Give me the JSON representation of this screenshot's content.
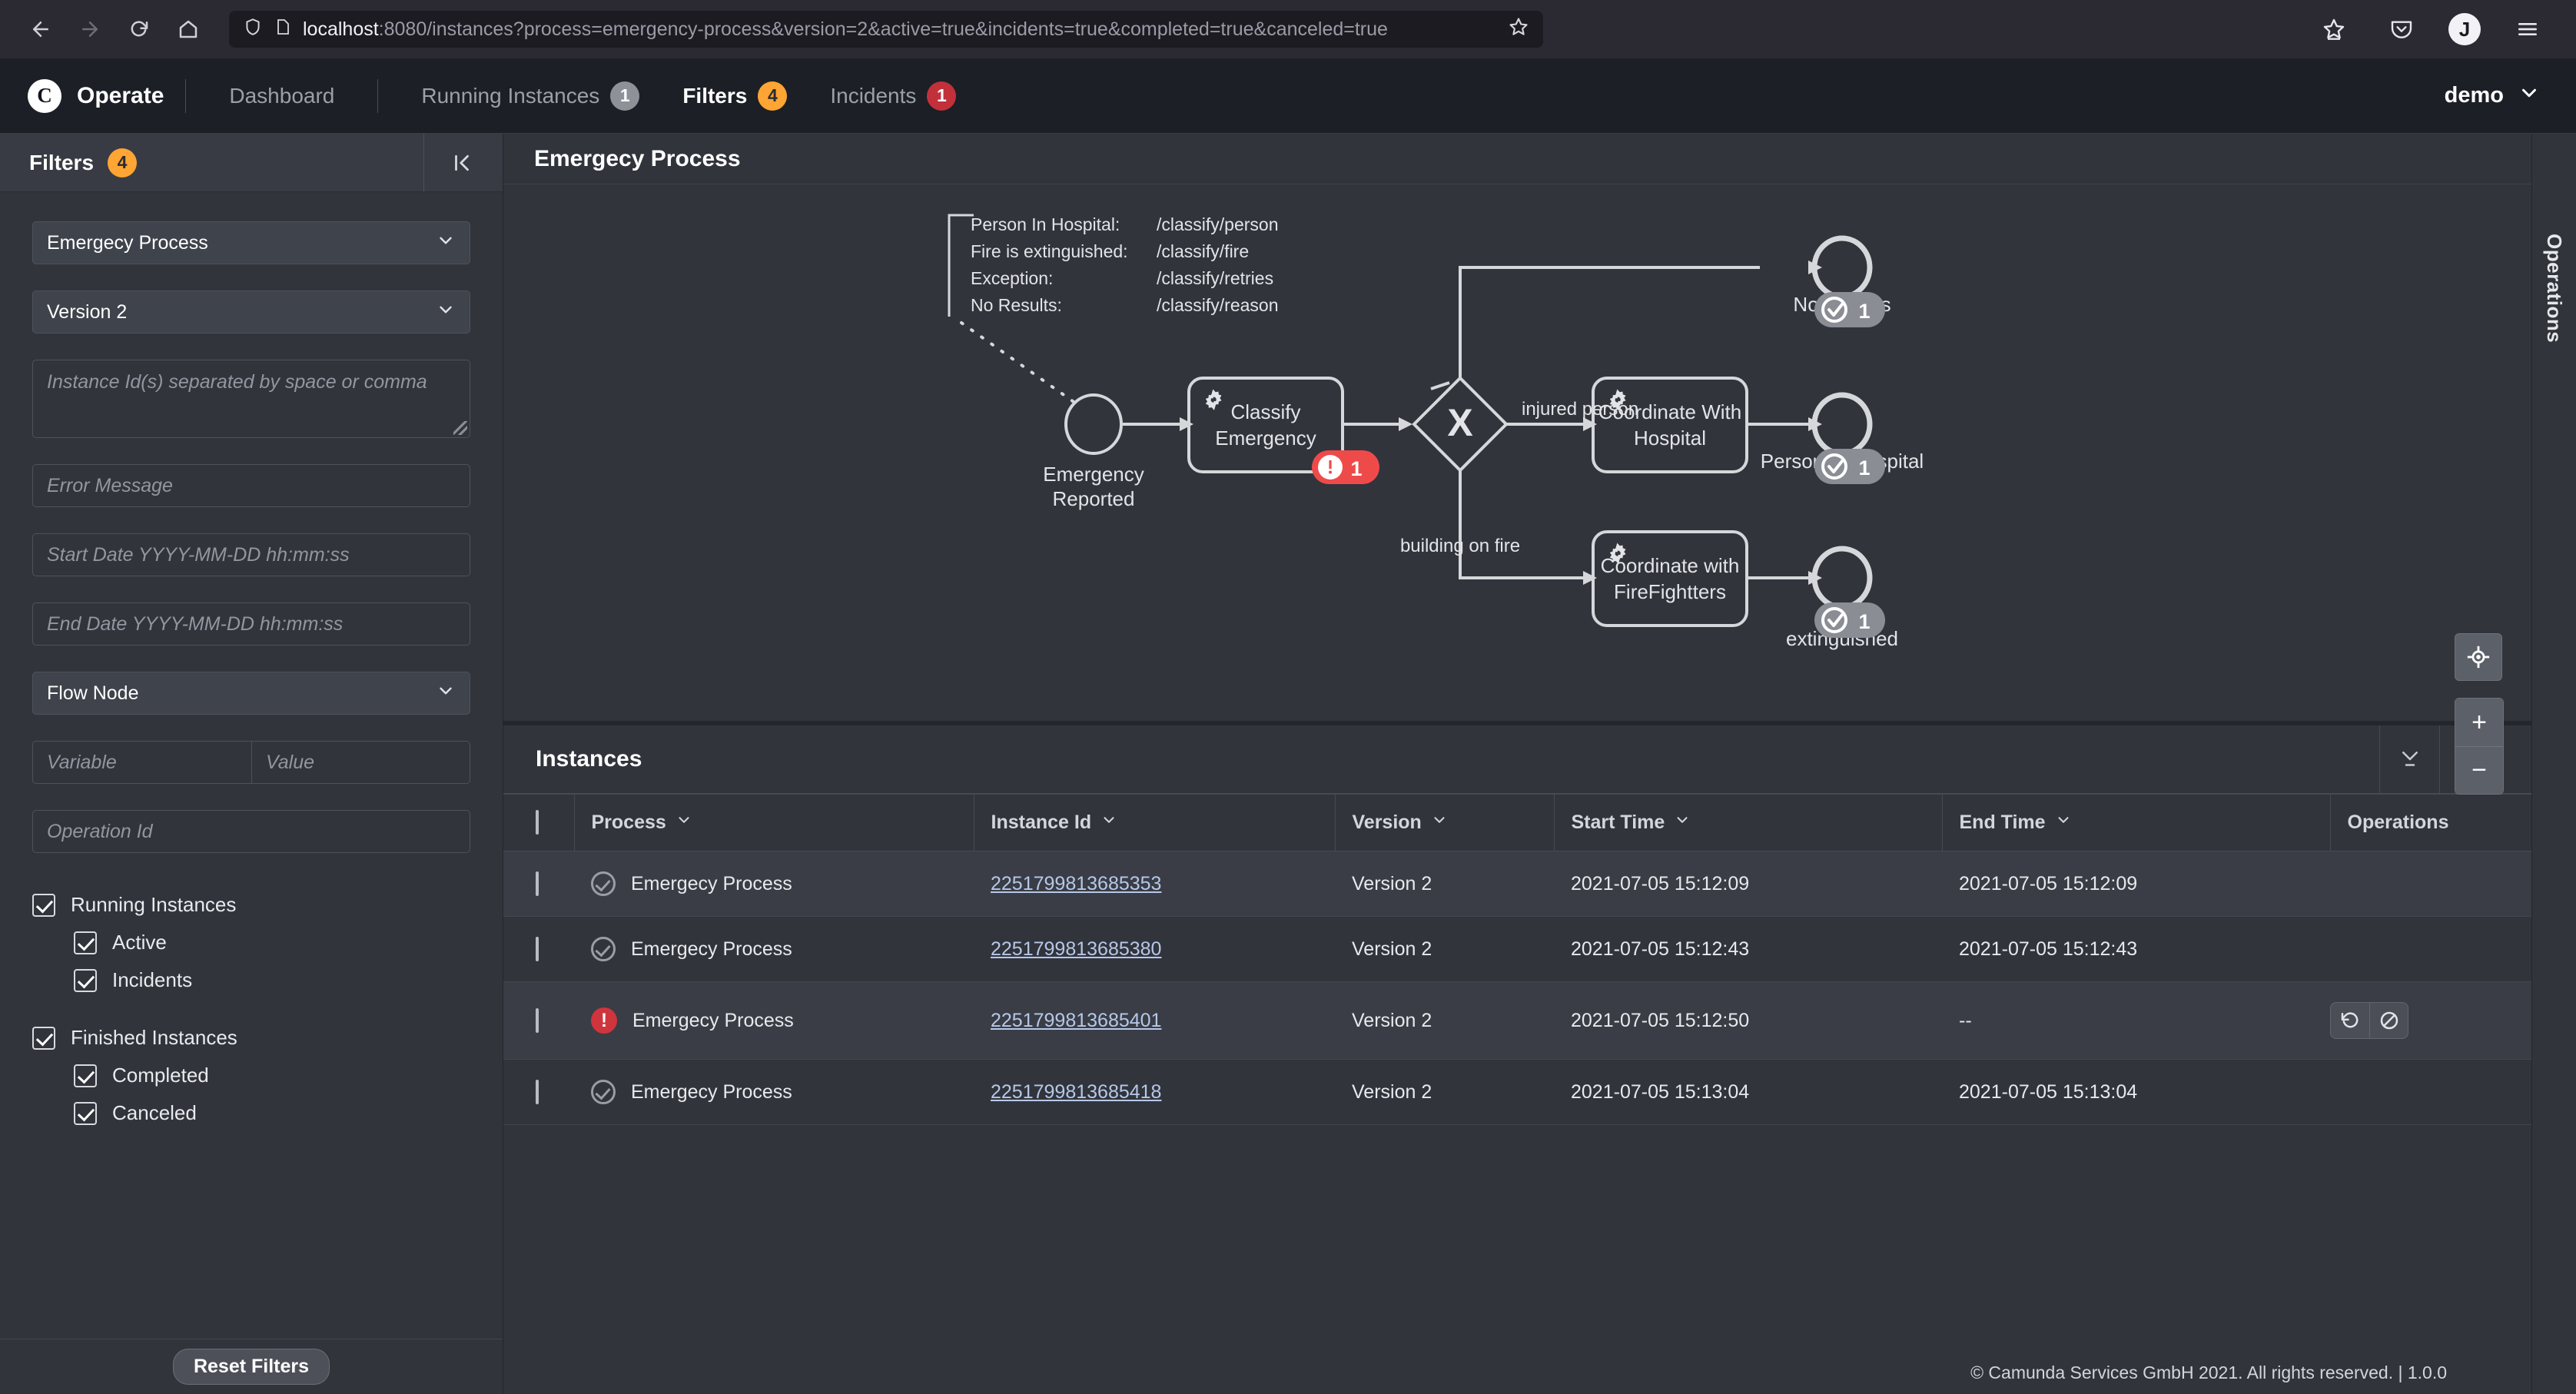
{
  "browser": {
    "icons": {
      "back": "back-arrow-icon",
      "forward": "forward-arrow-icon",
      "reload": "reload-icon",
      "home": "home-icon"
    },
    "url_host": "localhost",
    "url_rest": ":8080/instances?process=emergency-process&version=2&active=true&incidents=true&completed=true&canceled=true",
    "avatar_initial": "J"
  },
  "header": {
    "logo_letter": "C",
    "brand": "Operate",
    "nav": [
      {
        "label": "Dashboard",
        "badge": null,
        "badge_color": null,
        "active": false
      },
      {
        "label": "Running Instances",
        "badge": "1",
        "badge_color": "grey",
        "active": false
      },
      {
        "label": "Filters",
        "badge": "4",
        "badge_color": "orange",
        "active": true
      },
      {
        "label": "Incidents",
        "badge": "1",
        "badge_color": "red",
        "active": false
      }
    ],
    "user": "demo"
  },
  "sidebar": {
    "title": "Filters",
    "badge": "4",
    "process_select": "Emergecy Process",
    "version_select": "Version 2",
    "instance_ids_placeholder": "Instance Id(s) separated by space or comma",
    "error_message_placeholder": "Error Message",
    "start_date_placeholder": "Start Date YYYY-MM-DD hh:mm:ss",
    "end_date_placeholder": "End Date YYYY-MM-DD hh:mm:ss",
    "flow_node_select": "Flow Node",
    "variable_placeholder": "Variable",
    "value_placeholder": "Value",
    "operation_id_placeholder": "Operation Id",
    "checkboxes": {
      "running_instances": "Running Instances",
      "active": "Active",
      "incidents": "Incidents",
      "finished_instances": "Finished Instances",
      "completed": "Completed",
      "canceled": "Canceled"
    },
    "reset_button": "Reset Filters"
  },
  "diagram": {
    "title": "Emergecy Process",
    "annotation": [
      {
        "key": "Person In Hospital:",
        "value": "/classify/person"
      },
      {
        "key": "Fire is extinguished:",
        "value": "/classify/fire"
      },
      {
        "key": "Exception:",
        "value": "/classify/retries"
      },
      {
        "key": "No Results:",
        "value": "/classify/reason"
      }
    ],
    "nodes": {
      "start_event": "Emergency\nReported",
      "classify_task": "Classify\nEmergency",
      "gateway": "X",
      "coordinate_hospital": "Coordinate With\nHospital",
      "coordinate_firefighters": "Coordinate with\nFireFightters",
      "end_no_results": "No Results",
      "end_person_hospital": "Person In Hospital",
      "end_extinguished": "extinguished"
    },
    "flow_labels": {
      "injured": "injured person",
      "fire": "building on fire"
    },
    "badges": {
      "incident_classify": "1",
      "completed_no_results": "1",
      "completed_person_hospital": "1",
      "completed_extinguished": "1"
    },
    "zoom_controls": {
      "reset": "reset-zoom-icon",
      "in": "+",
      "out": "−"
    }
  },
  "instances": {
    "title": "Instances",
    "columns": [
      "Process",
      "Instance Id",
      "Version",
      "Start Time",
      "End Time",
      "Operations"
    ],
    "rows": [
      {
        "state": "ok",
        "process": "Emergecy Process",
        "id": "2251799813685353",
        "version": "Version 2",
        "start": "2021-07-05 15:12:09",
        "end": "2021-07-05 15:12:09",
        "ops": false,
        "selected": true
      },
      {
        "state": "ok",
        "process": "Emergecy Process",
        "id": "2251799813685380",
        "version": "Version 2",
        "start": "2021-07-05 15:12:43",
        "end": "2021-07-05 15:12:43",
        "ops": false,
        "selected": false
      },
      {
        "state": "error",
        "process": "Emergecy Process",
        "id": "2251799813685401",
        "version": "Version 2",
        "start": "2021-07-05 15:12:50",
        "end": "--",
        "ops": true,
        "selected": true
      },
      {
        "state": "ok",
        "process": "Emergecy Process",
        "id": "2251799813685418",
        "version": "Version 2",
        "start": "2021-07-05 15:13:04",
        "end": "2021-07-05 15:13:04",
        "ops": false,
        "selected": false
      }
    ]
  },
  "operations_rail": {
    "label": "Operations"
  },
  "footer": {
    "text": "© Camunda Services GmbH 2021. All rights reserved. | 1.0.0"
  },
  "colors": {
    "accent_orange": "#ffa533",
    "incident_red": "#c2303a",
    "grey_badge": "#8e9198",
    "link_blue": "#b6c8e8",
    "panel_bg": "#32343c",
    "page_bg": "#2c2c34"
  }
}
